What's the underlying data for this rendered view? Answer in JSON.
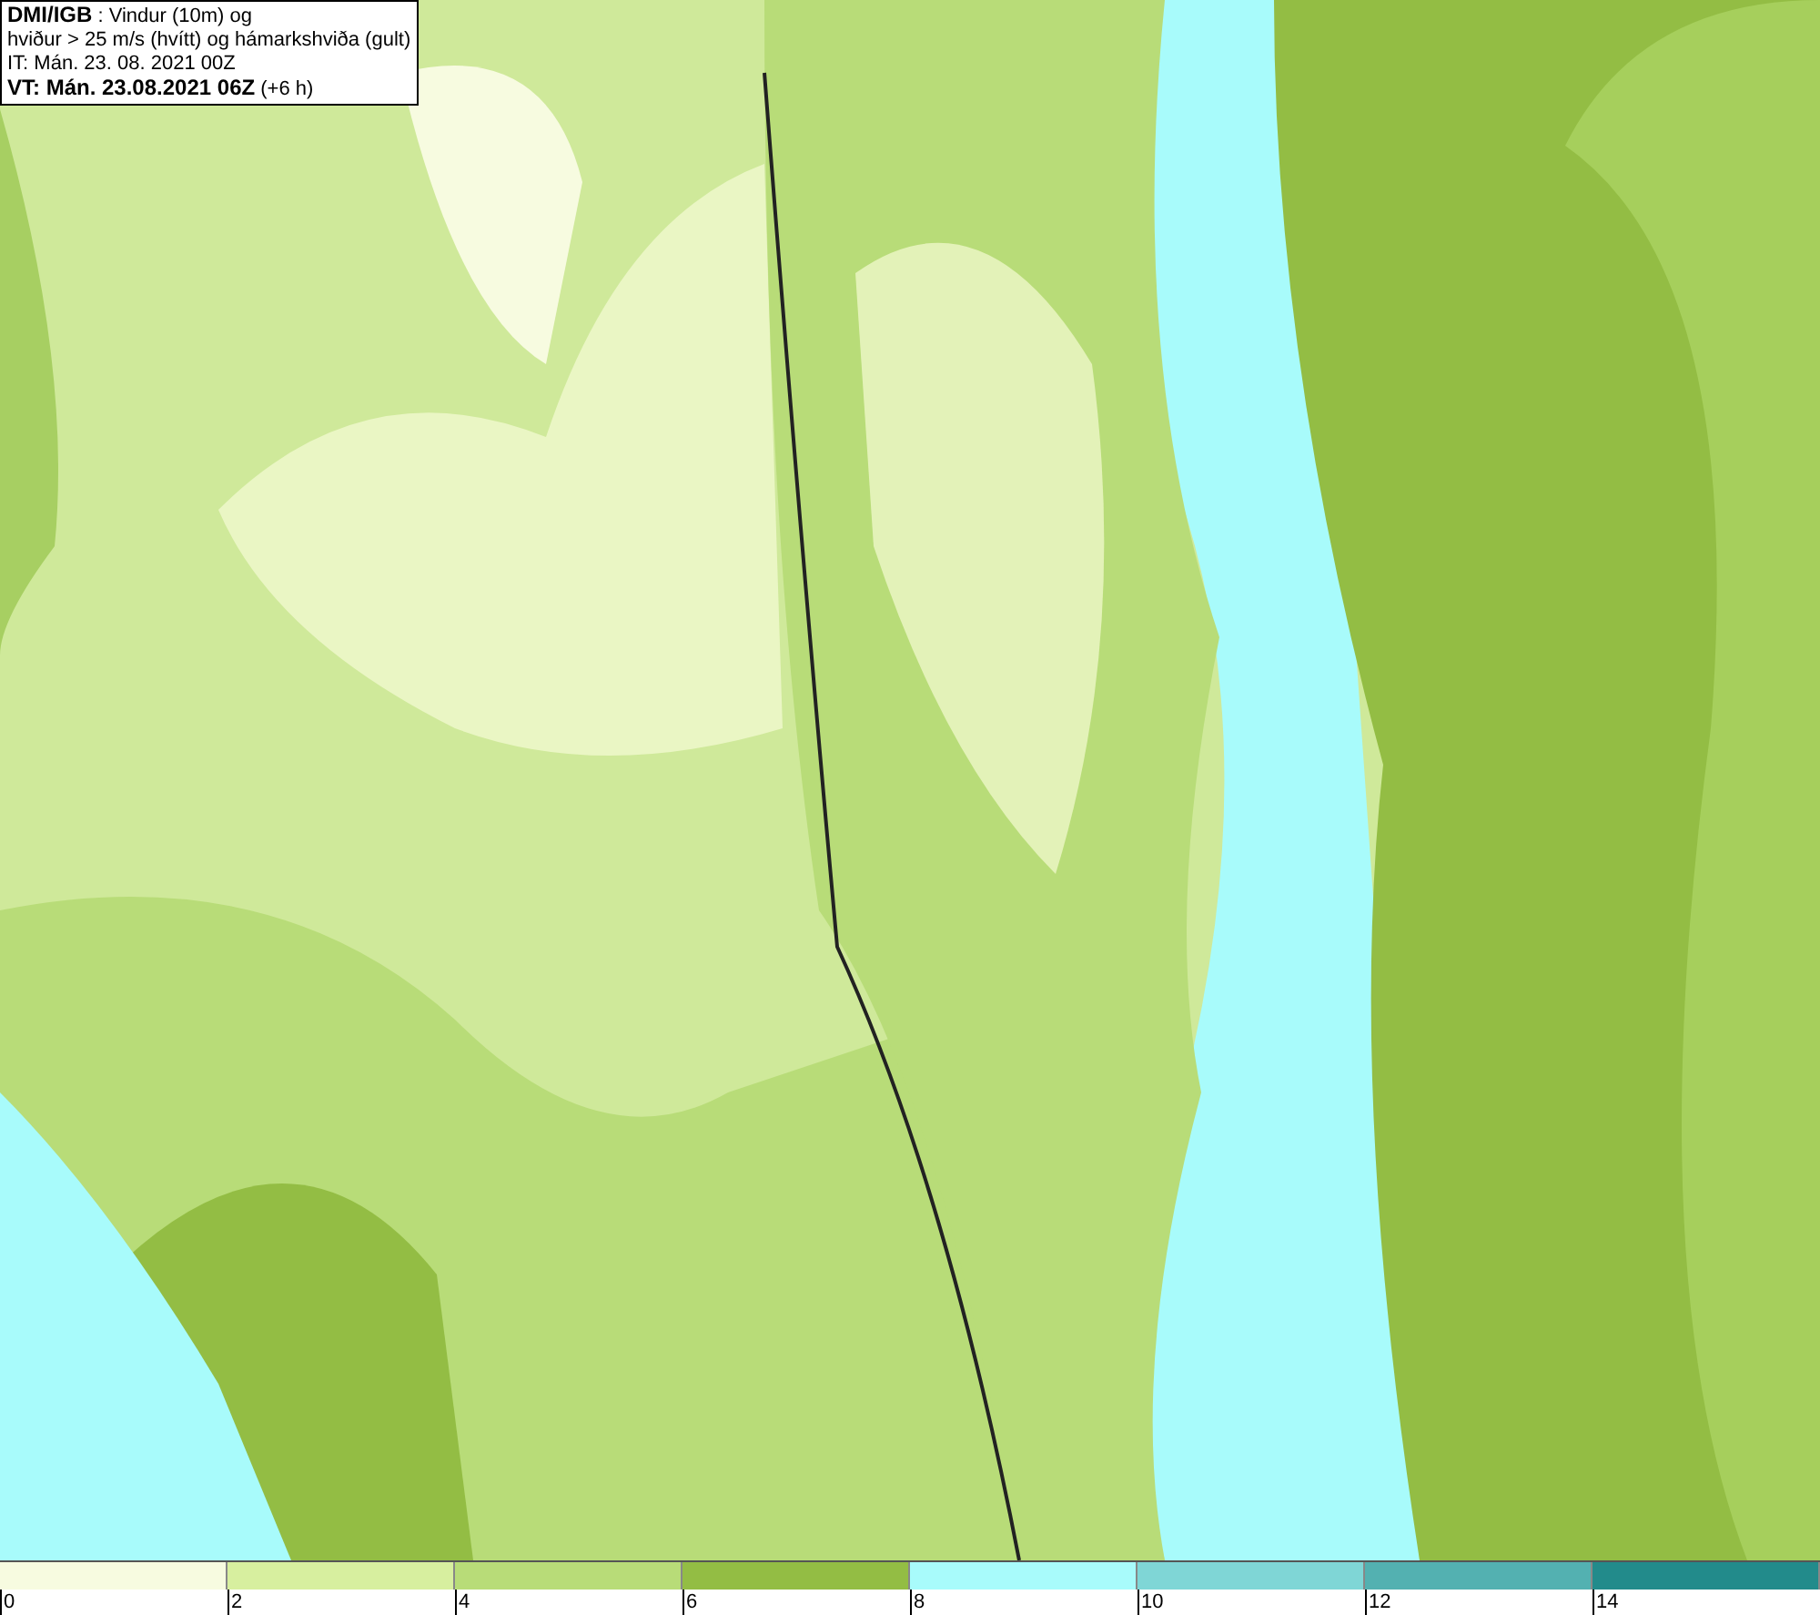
{
  "header": {
    "lines": [
      "**DMI/IGB** : Vindur (10m) og",
      "hviður > 25 m/s (hvítt) og hámarkshviða (gult)",
      "IT: Mán. 23. 08. 2021 00Z",
      "**VT: Mán. 23.08.2021 06Z** (+6 h)"
    ]
  },
  "legend": {
    "swatches": [
      {
        "color": "#f7fbe0"
      },
      {
        "color": "#d7ef9f"
      },
      {
        "color": "#b8dc78"
      },
      {
        "color": "#93bd44"
      },
      {
        "color": "#a8fbfb"
      },
      {
        "color": "#7fd6d6"
      },
      {
        "color": "#53b1b1"
      },
      {
        "color": "#228b8b"
      }
    ],
    "ticks": [
      "0",
      "2",
      "4",
      "6",
      "8",
      "10",
      "12",
      "14"
    ]
  }
}
